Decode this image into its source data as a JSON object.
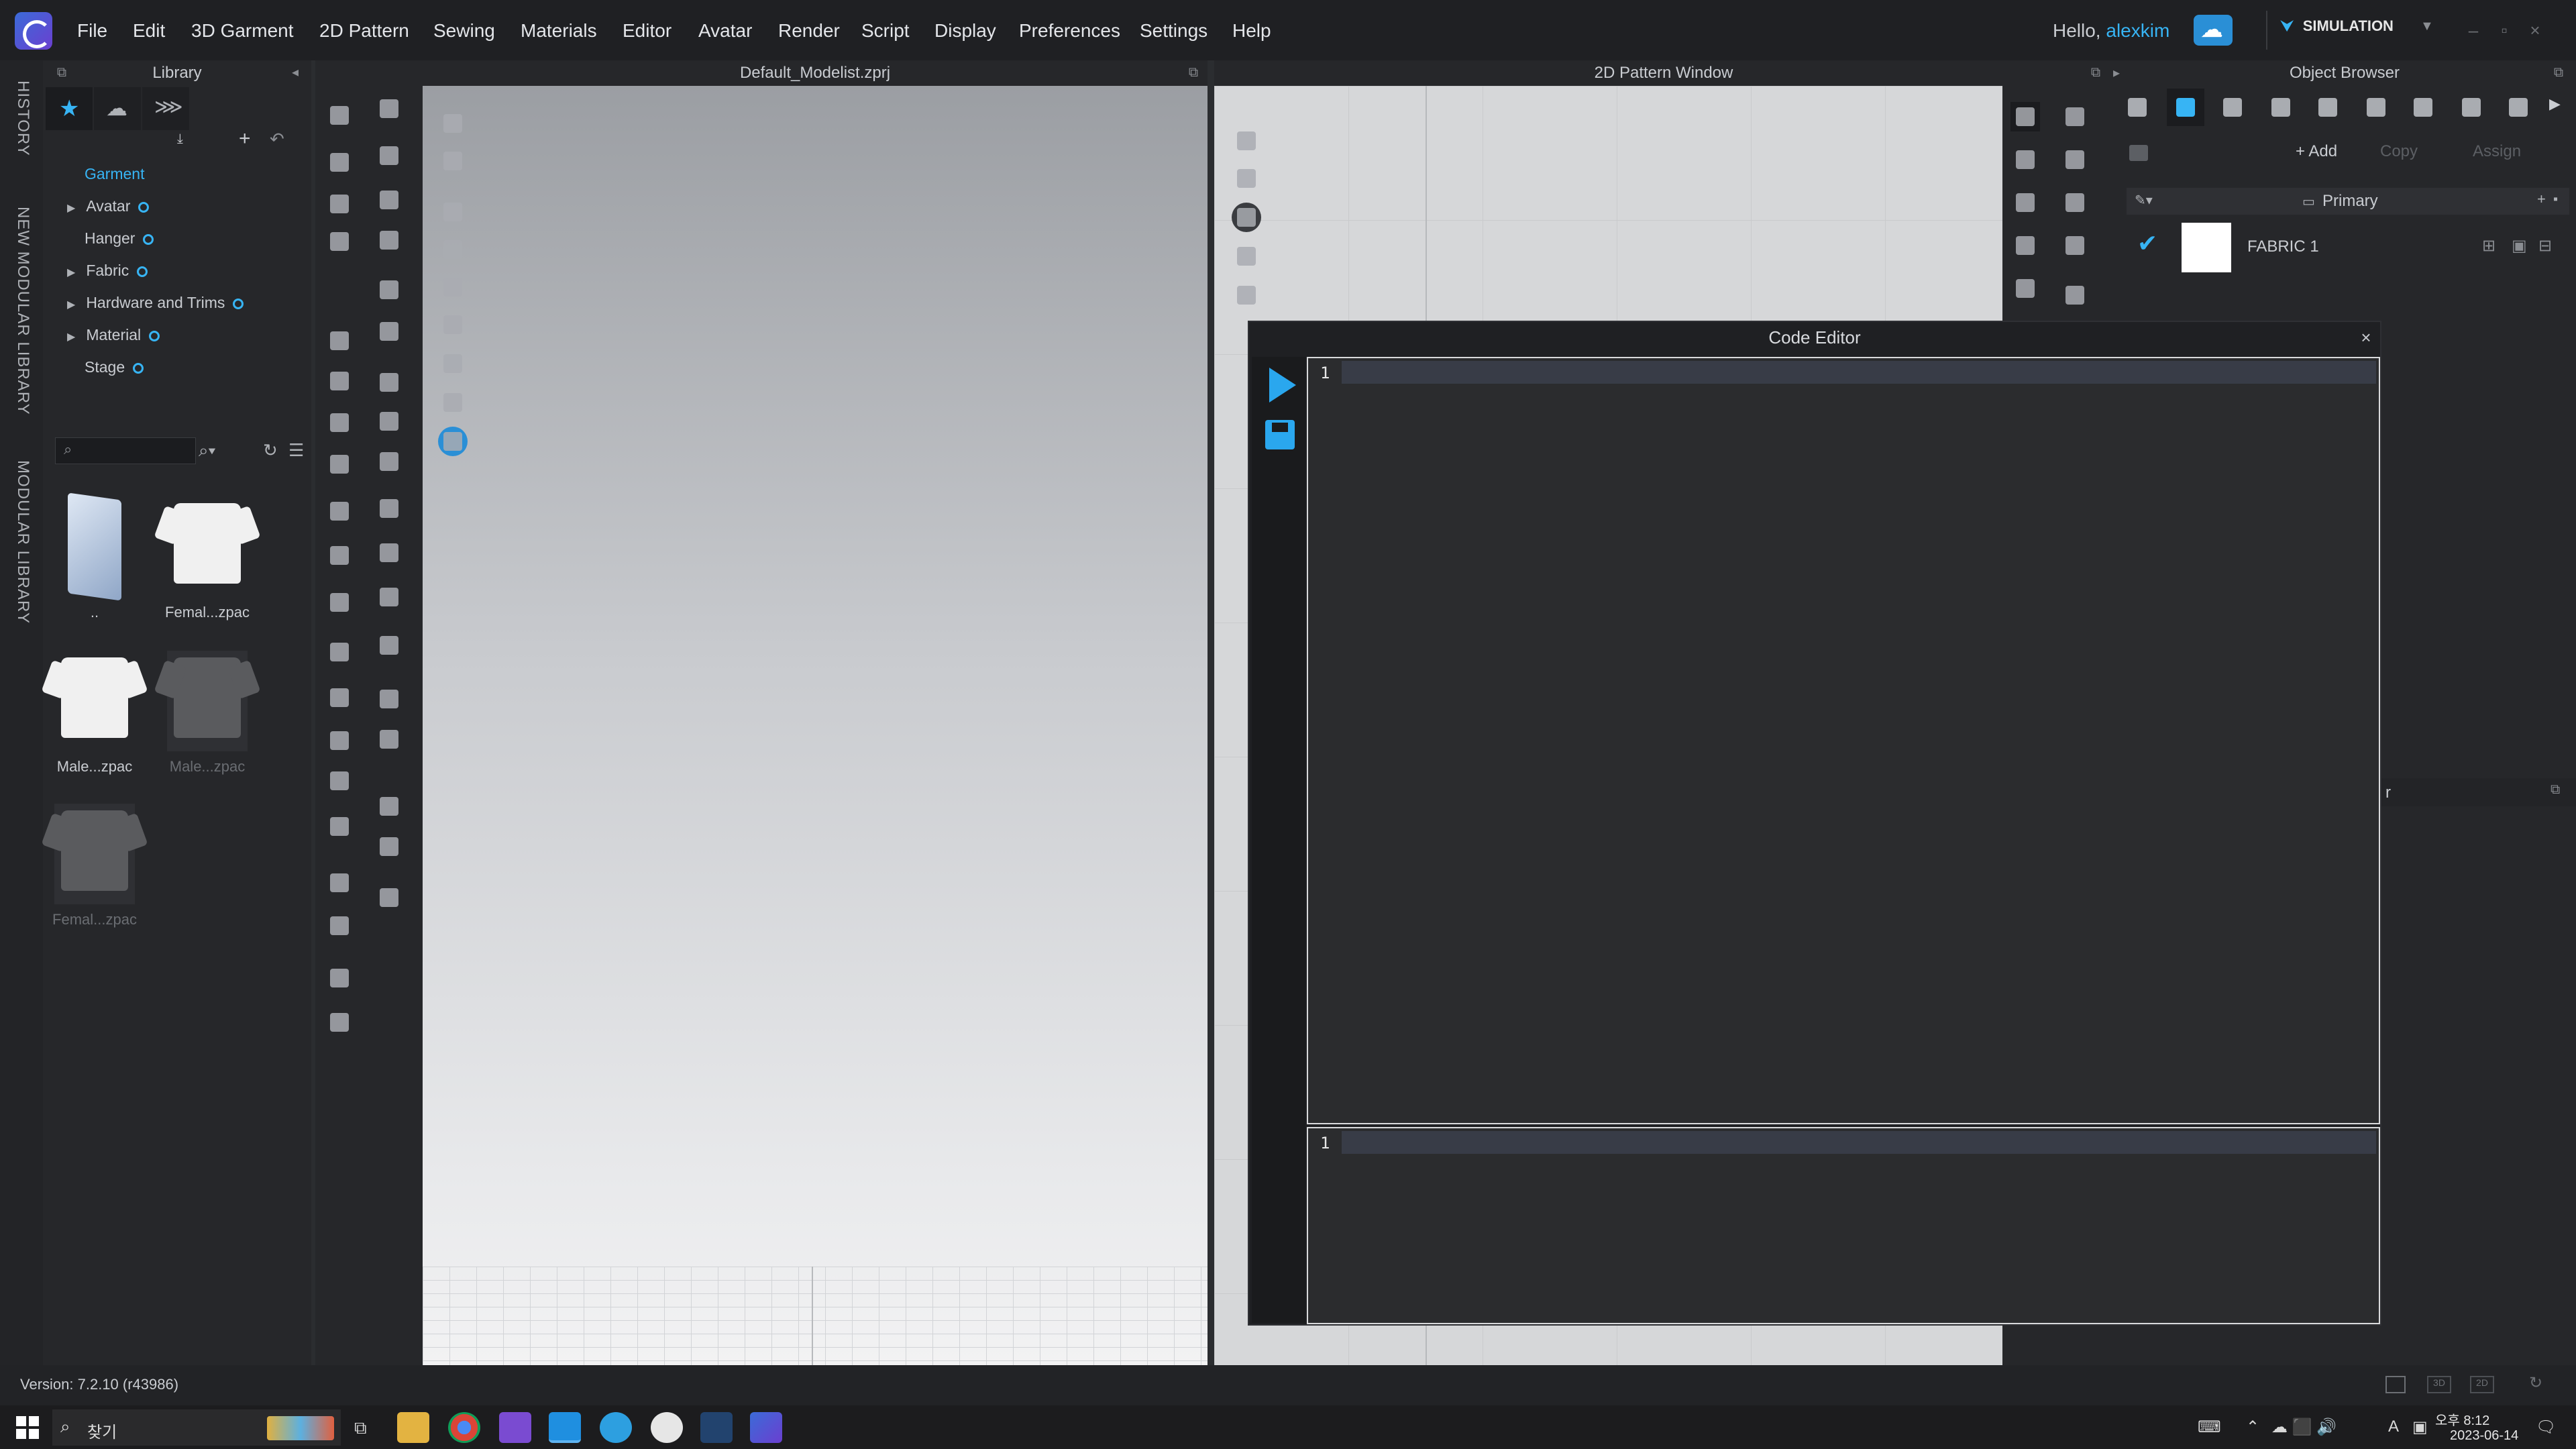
{
  "menu": {
    "items": [
      "File",
      "Edit",
      "3D Garment",
      "2D Pattern",
      "Sewing",
      "Materials",
      "Editor",
      "Avatar",
      "Render",
      "Script",
      "Display",
      "Preferences",
      "Settings",
      "Help"
    ],
    "greeting_prefix": "Hello, ",
    "user": "alexkim",
    "mode": "SIMULATION"
  },
  "side_tabs": [
    "HISTORY",
    "NEW MODULAR LIBRARY",
    "MODULAR LIBRARY"
  ],
  "library": {
    "title": "Library",
    "tree": [
      {
        "label": "Garment",
        "selected": true,
        "expandable": false,
        "dot": false
      },
      {
        "label": "Avatar",
        "expandable": true,
        "dot": true
      },
      {
        "label": "Hanger",
        "expandable": false,
        "dot": true
      },
      {
        "label": "Fabric",
        "expandable": true,
        "dot": true
      },
      {
        "label": "Hardware and Trims",
        "expandable": true,
        "dot": true
      },
      {
        "label": "Material",
        "expandable": true,
        "dot": true
      },
      {
        "label": "Stage",
        "expandable": false,
        "dot": true
      }
    ],
    "thumbnails": [
      {
        "caption": "..",
        "kind": "folder"
      },
      {
        "caption": "Femal...zpac",
        "kind": "shirt-white"
      },
      {
        "caption": "Male...zpac",
        "kind": "shirt-white"
      },
      {
        "caption": "Male...zpac",
        "kind": "shirt-dark",
        "dim": true
      },
      {
        "caption": "Femal...zpac",
        "kind": "shirt-dark",
        "dim": true
      }
    ]
  },
  "window3d": {
    "title": "Default_Modelist.zprj"
  },
  "window2d": {
    "title": "2D Pattern Window"
  },
  "object_browser": {
    "title": "Object Browser",
    "add_label": "+ Add",
    "copy_label": "Copy",
    "assign_label": "Assign",
    "group_label": "Primary",
    "fabric_name": "FABRIC 1",
    "partial_label": "r"
  },
  "code_editor": {
    "title": "Code Editor",
    "editor_line": "1",
    "console_line": "1"
  },
  "status": {
    "version": "Version: 7.2.10 (r43986)"
  },
  "taskbar": {
    "search_placeholder": "찾기",
    "time": "오후 8:12",
    "date": "2023-06-14",
    "ime": "A",
    "accent": "#37b4f4"
  }
}
